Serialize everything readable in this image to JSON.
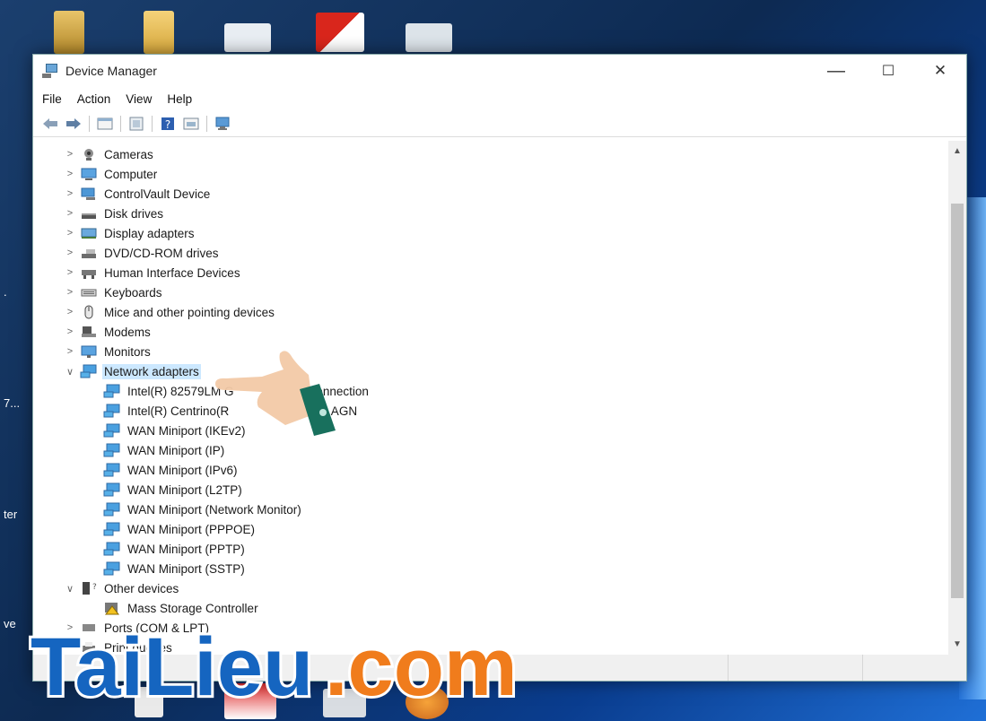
{
  "window": {
    "title": "Device Manager"
  },
  "window_controls": {
    "minimize": "—",
    "maximize": "☐",
    "close": "✕"
  },
  "menu": [
    "File",
    "Action",
    "View",
    "Help"
  ],
  "desktop": {
    "labels": [
      ".",
      "7...",
      "ter",
      "ve"
    ]
  },
  "tree": [
    {
      "label": "Cameras",
      "level": 1,
      "expanded": false,
      "icon": "camera-icon"
    },
    {
      "label": "Computer",
      "level": 1,
      "expanded": false,
      "icon": "computer-icon"
    },
    {
      "label": "ControlVault Device",
      "level": 1,
      "expanded": false,
      "icon": "device-icon"
    },
    {
      "label": "Disk drives",
      "level": 1,
      "expanded": false,
      "icon": "disk-icon"
    },
    {
      "label": "Display adapters",
      "level": 1,
      "expanded": false,
      "icon": "display-icon"
    },
    {
      "label": "DVD/CD-ROM drives",
      "level": 1,
      "expanded": false,
      "icon": "dvd-icon"
    },
    {
      "label": "Human Interface Devices",
      "level": 1,
      "expanded": false,
      "icon": "hid-icon"
    },
    {
      "label": "Keyboards",
      "level": 1,
      "expanded": false,
      "icon": "keyboard-icon"
    },
    {
      "label": "Mice and other pointing devices",
      "level": 1,
      "expanded": false,
      "icon": "mouse-icon"
    },
    {
      "label": "Modems",
      "level": 1,
      "expanded": false,
      "icon": "modem-icon"
    },
    {
      "label": "Monitors",
      "level": 1,
      "expanded": false,
      "icon": "monitor-icon"
    },
    {
      "label": "Network adapters",
      "level": 1,
      "expanded": true,
      "selected": true,
      "icon": "network-icon"
    },
    {
      "label": "Intel(R) 82579LM G",
      "suffix": "Connection",
      "level": 2,
      "icon": "network-icon"
    },
    {
      "label": "Intel(R) Centrino(R",
      "suffix": "300 AGN",
      "level": 2,
      "icon": "network-icon"
    },
    {
      "label": "WAN Miniport (IKEv2)",
      "level": 2,
      "icon": "network-icon"
    },
    {
      "label": "WAN Miniport (IP)",
      "level": 2,
      "icon": "network-icon"
    },
    {
      "label": "WAN Miniport (IPv6)",
      "level": 2,
      "icon": "network-icon"
    },
    {
      "label": "WAN Miniport (L2TP)",
      "level": 2,
      "icon": "network-icon"
    },
    {
      "label": "WAN Miniport (Network Monitor)",
      "level": 2,
      "icon": "network-icon"
    },
    {
      "label": "WAN Miniport (PPPOE)",
      "level": 2,
      "icon": "network-icon"
    },
    {
      "label": "WAN Miniport (PPTP)",
      "level": 2,
      "icon": "network-icon"
    },
    {
      "label": "WAN Miniport (SSTP)",
      "level": 2,
      "icon": "network-icon"
    },
    {
      "label": "Other devices",
      "level": 1,
      "expanded": true,
      "icon": "other-devices-icon"
    },
    {
      "label": "Mass Storage Controller",
      "level": 2,
      "icon": "warning-device-icon"
    },
    {
      "label": "Ports (COM & LPT)",
      "level": 1,
      "expanded": false,
      "icon": "port-icon"
    },
    {
      "label": "Print queues",
      "level": 1,
      "expanded": false,
      "icon": "printer-icon"
    }
  ],
  "watermark": {
    "text": "TaiLieu.com"
  },
  "colors": {
    "accent": "#3c8dd8",
    "selection": "#cce8ff",
    "watermark_blue": "#1565c0",
    "watermark_orange": "#f07c1c"
  }
}
